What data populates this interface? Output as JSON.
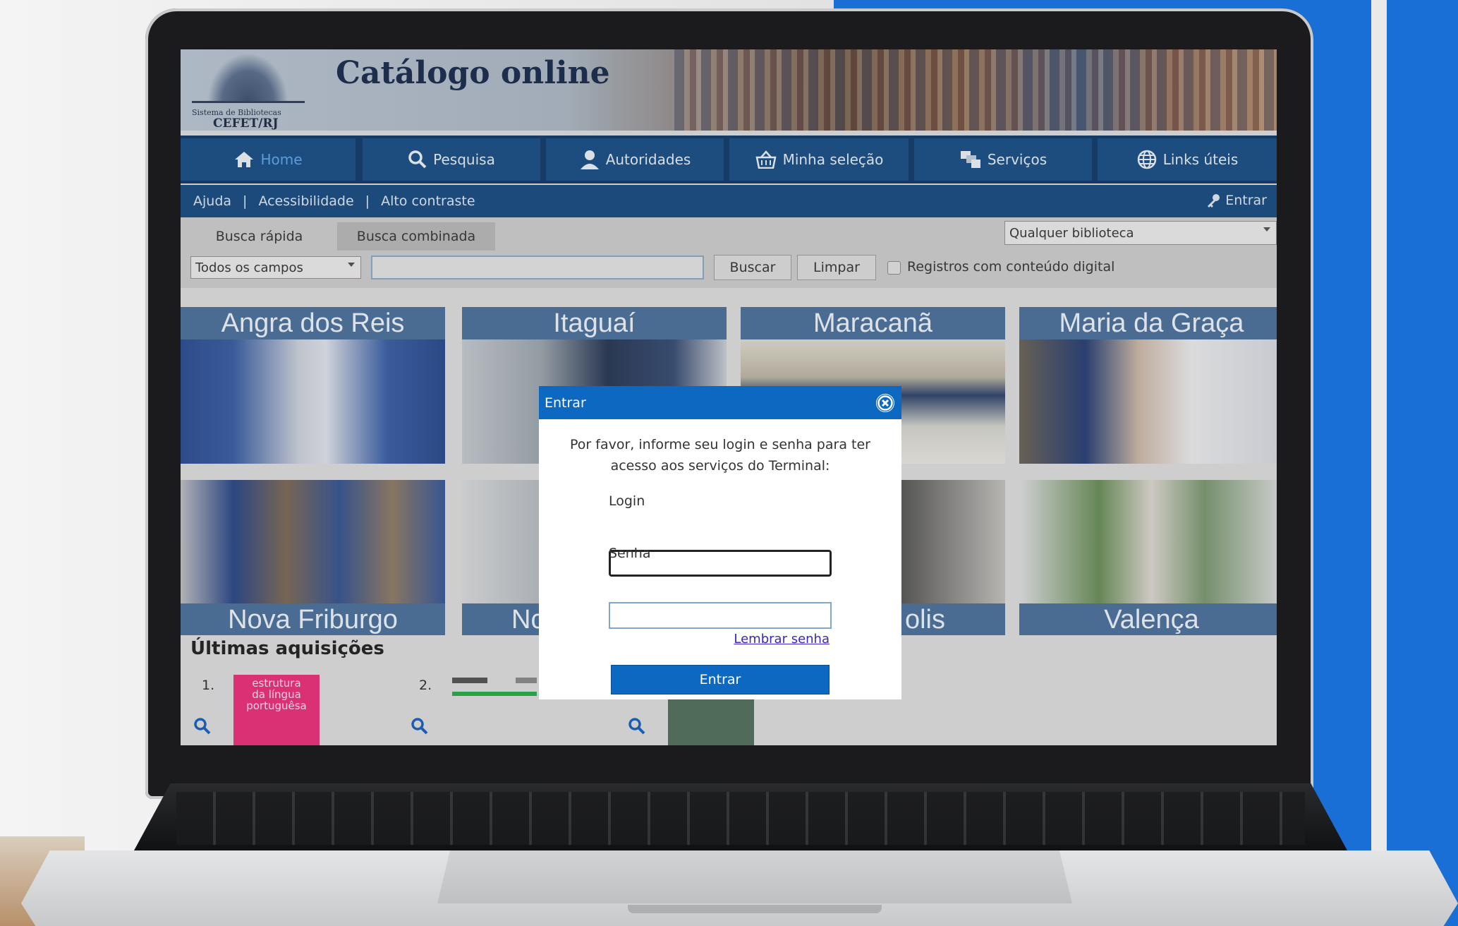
{
  "header": {
    "logo_small": "Sistema de Bibliotecas",
    "logo_big": "CEFET/RJ",
    "title": "Catálogo online"
  },
  "nav": [
    {
      "label": "Home",
      "icon": "home-icon"
    },
    {
      "label": "Pesquisa",
      "icon": "search-icon"
    },
    {
      "label": "Autoridades",
      "icon": "person-icon"
    },
    {
      "label": "Minha seleção",
      "icon": "basket-icon"
    },
    {
      "label": "Serviços",
      "icon": "services-icon"
    },
    {
      "label": "Links úteis",
      "icon": "globe-icon"
    }
  ],
  "subnav": {
    "ajuda": "Ajuda",
    "acessibilidade": "Acessibilidade",
    "alto_contraste": "Alto contraste",
    "entrar": "Entrar"
  },
  "search": {
    "tab_rapida": "Busca rápida",
    "tab_combinada": "Busca combinada",
    "library_select": "Qualquer biblioteca",
    "field_select": "Todos os campos",
    "query": "",
    "buscar": "Buscar",
    "limpar": "Limpar",
    "digital_label": "Registros com conteúdo digital"
  },
  "campuses": [
    "Angra dos Reis",
    "Itaguaí",
    "Maracanã",
    "Maria da Graça",
    "Nova Friburgo",
    "Nc",
    "olis",
    "Valença"
  ],
  "acquisitions": {
    "heading": "Últimas aquisições",
    "items": [
      {
        "num": "1.",
        "cover_text": [
          "estrutura",
          "da língua",
          "portuguêsa"
        ]
      },
      {
        "num": "2."
      }
    ]
  },
  "modal": {
    "title": "Entrar",
    "message": "Por favor, informe seu login e senha para ter acesso aos serviços do Terminal:",
    "login_label": "Login",
    "login_value": "",
    "senha_label": "Senha",
    "senha_value": "",
    "lembrar": "Lembrar senha",
    "submit": "Entrar"
  },
  "colors": {
    "nav": "#1f5184",
    "modal_header": "#0d68c1",
    "background_blue": "#1a6fd6"
  }
}
